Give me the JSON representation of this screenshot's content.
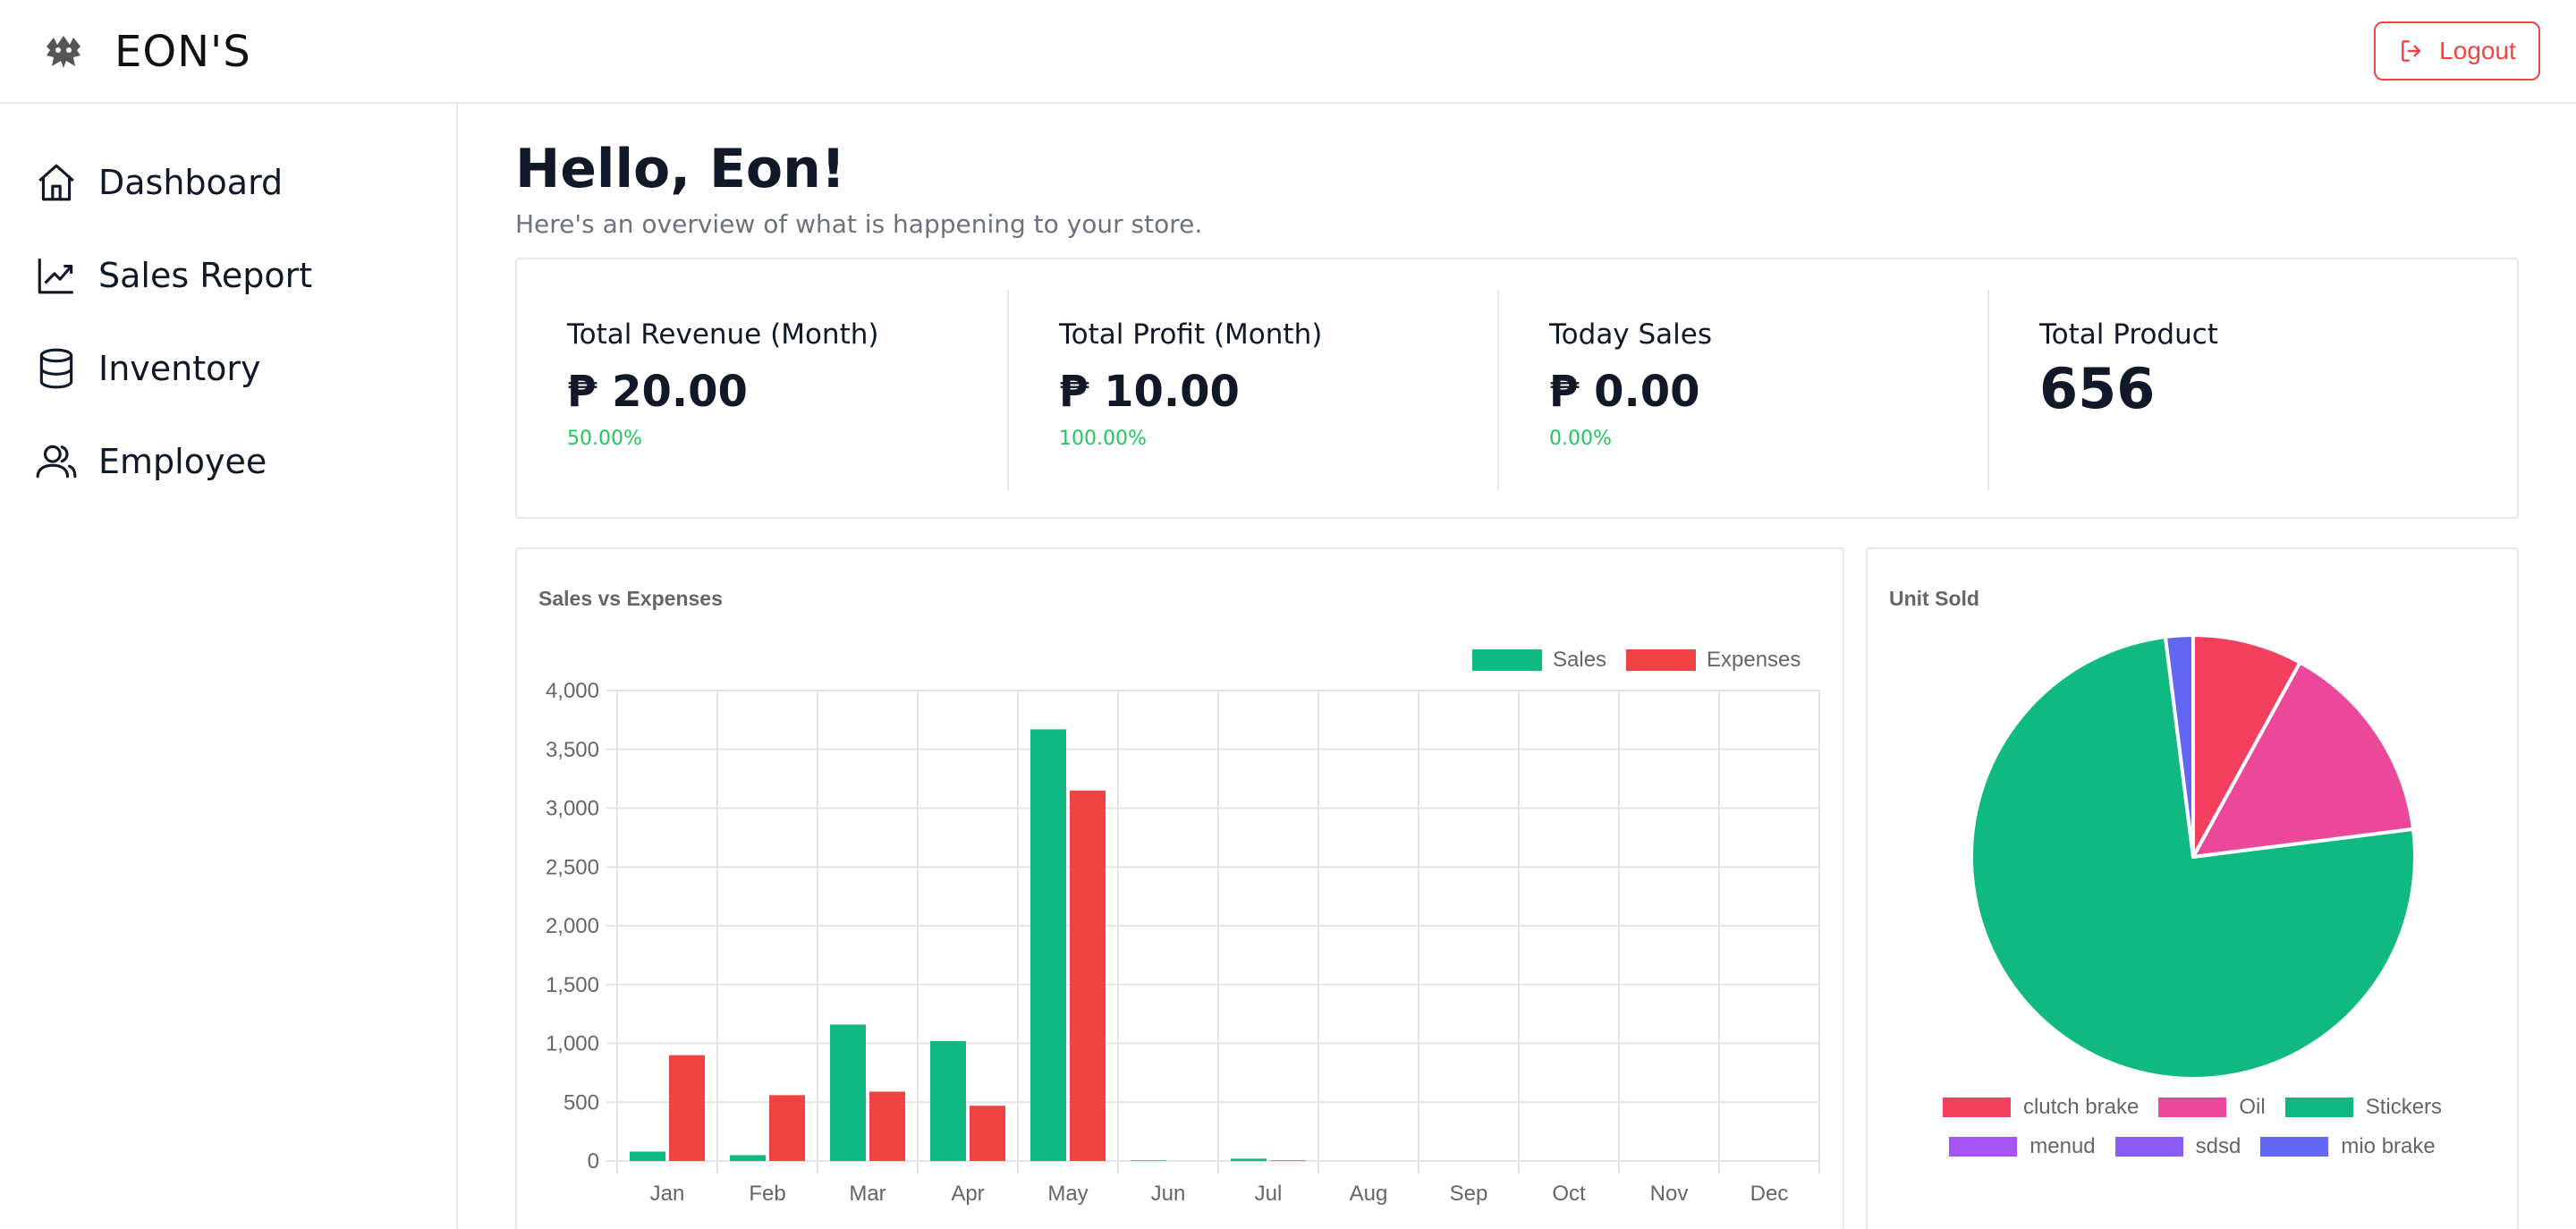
{
  "header": {
    "brand": "EON'S",
    "logout_label": "Logout"
  },
  "sidebar": {
    "items": [
      {
        "label": "Dashboard",
        "icon": "home-icon"
      },
      {
        "label": "Sales Report",
        "icon": "trending-up-icon"
      },
      {
        "label": "Inventory",
        "icon": "database-icon"
      },
      {
        "label": "Employee",
        "icon": "users-icon"
      }
    ]
  },
  "main": {
    "greeting": "Hello, Eon!",
    "subtitle": "Here's an overview of what is happening to your store."
  },
  "stats": [
    {
      "label": "Total Revenue (Month)",
      "value": "₱ 20.00",
      "percent": "50.00%"
    },
    {
      "label": "Total Profit (Month)",
      "value": "₱ 10.00",
      "percent": "100.00%"
    },
    {
      "label": "Today Sales",
      "value": "₱ 0.00",
      "percent": "0.00%"
    },
    {
      "label": "Total Product",
      "value": "656",
      "percent": ""
    }
  ],
  "colors": {
    "sales": "#10b981",
    "expenses": "#ef4444",
    "accent_green": "#22c55e",
    "logout": "#ef4444"
  },
  "chart_data": [
    {
      "type": "bar",
      "title": "Sales vs Expenses",
      "categories": [
        "Jan",
        "Feb",
        "Mar",
        "Apr",
        "May",
        "Jun",
        "Jul",
        "Aug",
        "Sep",
        "Oct",
        "Nov",
        "Dec"
      ],
      "series": [
        {
          "name": "Sales",
          "color": "#10b981",
          "values": [
            80,
            50,
            1160,
            1020,
            3670,
            5,
            20,
            0,
            0,
            0,
            0,
            0
          ]
        },
        {
          "name": "Expenses",
          "color": "#ef4444",
          "values": [
            900,
            560,
            590,
            470,
            3150,
            0,
            5,
            0,
            0,
            0,
            0,
            0
          ]
        }
      ],
      "ylim": [
        0,
        4000
      ],
      "yticks": [
        "0",
        "500",
        "1,000",
        "1,500",
        "2,000",
        "2,500",
        "3,000",
        "3,500",
        "4,000"
      ],
      "grid": true,
      "legend": "top-right"
    },
    {
      "type": "pie",
      "title": "Unit Sold",
      "slices": [
        {
          "label": "clutch brake",
          "color": "#f43f5e",
          "value": 8
        },
        {
          "label": "Oil",
          "color": "#ec4899",
          "value": 15
        },
        {
          "label": "Stickers",
          "color": "#10b981",
          "value": 75
        },
        {
          "label": "menud",
          "color": "#a855f7",
          "value": 0
        },
        {
          "label": "sdsd",
          "color": "#8b5cf6",
          "value": 0
        },
        {
          "label": "mio brake",
          "color": "#6366f1",
          "value": 2
        }
      ],
      "legend": "bottom"
    }
  ]
}
